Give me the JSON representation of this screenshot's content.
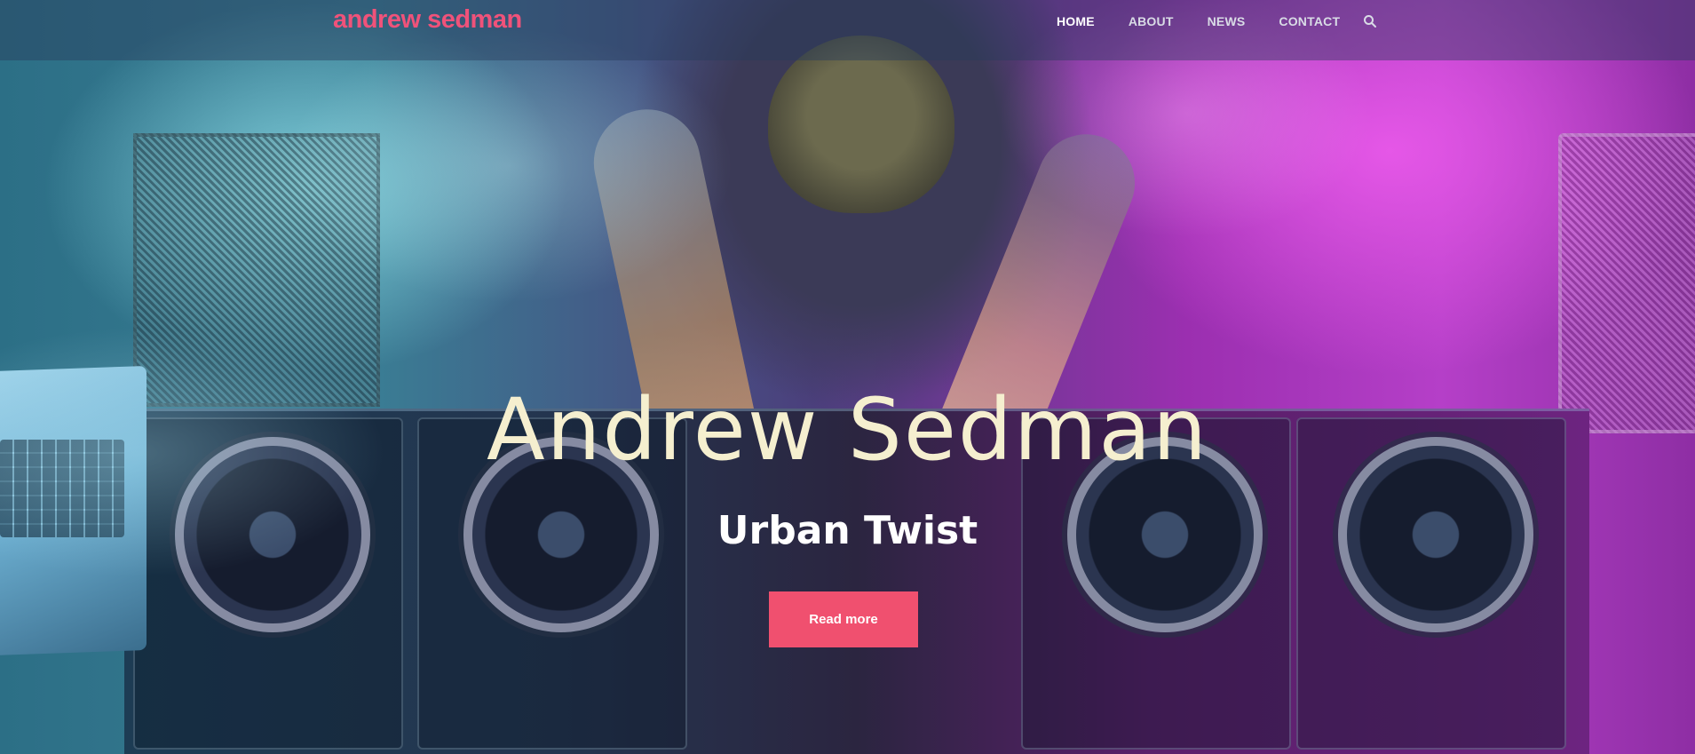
{
  "site": {
    "logo_text": "andrew sedman"
  },
  "nav": {
    "items": [
      {
        "label": "HOME",
        "active": true
      },
      {
        "label": "ABOUT",
        "active": false
      },
      {
        "label": "NEWS",
        "active": false
      },
      {
        "label": "CONTACT",
        "active": false
      }
    ],
    "search_icon": "search-icon"
  },
  "hero": {
    "title": "Andrew Sedman",
    "subtitle": "Urban Twist",
    "cta_label": "Read more"
  },
  "colors": {
    "accent": "#f0506f",
    "logo": "#f0527a",
    "title": "#f5efcf"
  }
}
